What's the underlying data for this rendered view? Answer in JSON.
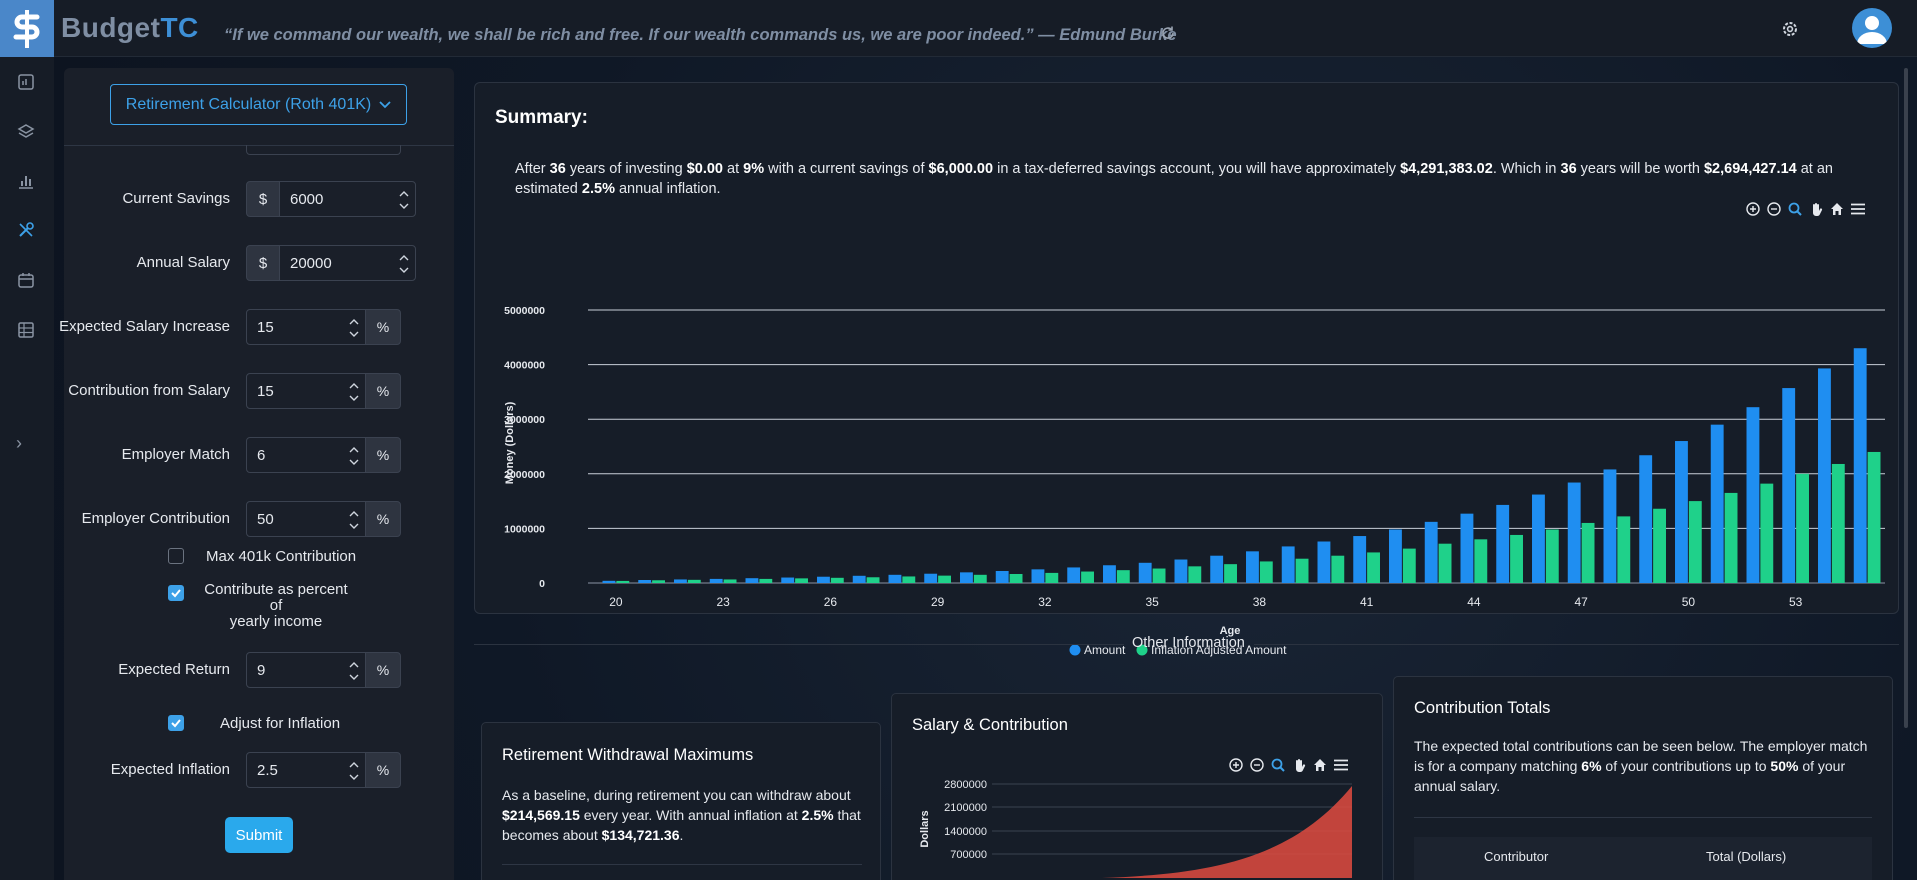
{
  "app": {
    "brand_budget": "Budget",
    "brand_tc": "TC",
    "quote": "“If we command our wealth, we shall be rich and free. If our wealth commands us, we are poor indeed.” — Edmund Burke"
  },
  "nav": {
    "icons": [
      "dashboard-icon",
      "layers-icon",
      "bar-chart-icon",
      "tools-icon",
      "calendar-icon",
      "table-icon"
    ],
    "expand_label": "›"
  },
  "form": {
    "calculator_select": "Retirement Calculator (Roth 401K)",
    "current_savings": {
      "label": "Current Savings",
      "prefix": "$",
      "value": "6000"
    },
    "annual_salary": {
      "label": "Annual Salary",
      "prefix": "$",
      "value": "20000"
    },
    "salary_increase": {
      "label": "Expected Salary Increase",
      "value": "15",
      "suffix": "%"
    },
    "contribution_from_salary": {
      "label": "Contribution from Salary",
      "value": "15",
      "suffix": "%"
    },
    "employer_match": {
      "label": "Employer Match",
      "value": "6",
      "suffix": "%"
    },
    "employer_contribution": {
      "label": "Employer Contribution",
      "value": "50",
      "suffix": "%"
    },
    "max_401k": {
      "label": "Max 401k Contribution",
      "checked": false
    },
    "contribute_percent": {
      "label_line1": "Contribute as percent of",
      "label_line2": "yearly income",
      "checked": true
    },
    "expected_return": {
      "label": "Expected Return",
      "value": "9",
      "suffix": "%"
    },
    "adjust_inflation": {
      "label": "Adjust for Inflation",
      "checked": true
    },
    "expected_inflation": {
      "label": "Expected Inflation",
      "value": "2.5",
      "suffix": "%"
    },
    "submit": "Submit"
  },
  "summary": {
    "title": "Summary:",
    "p1": "After ",
    "years": "36",
    "p2": " years of investing ",
    "investing": "$0.00",
    "p3": " at ",
    "rate": "9%",
    "p4": " with a current savings of ",
    "savings": "$6,000.00",
    "p5": " in a tax-deferred savings account, you will have approximately ",
    "total": "$4,291,383.02",
    "p6": ". Which in ",
    "years2": "36",
    "p7": " years will be worth ",
    "real_total": "$2,694,427.14",
    "p8": " at an estimated ",
    "inflation": "2.5%",
    "p9": " annual inflation."
  },
  "other_info": "Other Information",
  "withdrawal": {
    "title": "Retirement Withdrawal Maximums",
    "t1": "As a baseline, during retirement you can withdraw about ",
    "amount": "$214,569.15",
    "t2": " every year. With annual inflation at ",
    "inflation": "2.5%",
    "t3": " that becomes about ",
    "real_amount": "$134,721.36",
    "t4": "."
  },
  "salary_card": {
    "title": "Salary & Contribution",
    "ylabel": "Dollars",
    "yticks": [
      "2800000",
      "2100000",
      "1400000",
      "700000"
    ]
  },
  "totals_card": {
    "title": "Contribution Totals",
    "t1": "The expected total contributions can be seen below. The employer match is for a company matching ",
    "match": "6%",
    "t2": " of your contributions up to ",
    "pct": "50%",
    "t3": " of your annual salary.",
    "col1": "Contributor",
    "col2": "Total (Dollars)"
  },
  "chart_data": {
    "type": "bar",
    "title": "",
    "xlabel": "Age",
    "ylabel": "Money (Dollars)",
    "ylim": [
      0,
      5000000
    ],
    "yticks": [
      0,
      1000000,
      2000000,
      3000000,
      4000000,
      5000000
    ],
    "xtick_labels": [
      "20",
      "23",
      "26",
      "29",
      "32",
      "35",
      "38",
      "41",
      "44",
      "47",
      "50",
      "53"
    ],
    "categories": [
      20,
      21,
      22,
      23,
      24,
      25,
      26,
      27,
      28,
      29,
      30,
      31,
      32,
      33,
      34,
      35,
      36,
      37,
      38,
      39,
      40,
      41,
      42,
      43,
      44,
      45,
      46,
      47,
      48,
      49,
      50,
      51,
      52,
      53,
      54,
      55
    ],
    "legend_position": "bottom",
    "series": [
      {
        "name": "Amount",
        "color": "#1f8ef1",
        "values": [
          40000,
          55000,
          65000,
          75000,
          88000,
          100000,
          115000,
          132000,
          150000,
          170000,
          195000,
          220000,
          250000,
          285000,
          325000,
          370000,
          430000,
          500000,
          580000,
          670000,
          760000,
          860000,
          980000,
          1120000,
          1270000,
          1430000,
          1620000,
          1840000,
          2080000,
          2340000,
          2600000,
          2900000,
          3220000,
          3570000,
          3930000,
          4300000
        ]
      },
      {
        "name": "Inflation Adjusted Amount",
        "color": "#1fd18a",
        "values": [
          38000,
          50000,
          58000,
          65000,
          75000,
          85000,
          95000,
          105000,
          120000,
          135000,
          150000,
          165000,
          185000,
          210000,
          235000,
          265000,
          305000,
          345000,
          395000,
          445000,
          500000,
          560000,
          630000,
          720000,
          800000,
          880000,
          980000,
          1100000,
          1220000,
          1360000,
          1500000,
          1650000,
          1820000,
          2000000,
          2180000,
          2400000
        ]
      }
    ]
  }
}
